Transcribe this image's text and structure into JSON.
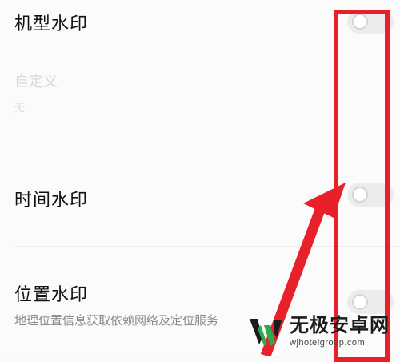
{
  "settings": {
    "model_watermark": {
      "title": "机型水印"
    },
    "custom": {
      "label": "自定义",
      "value": "无"
    },
    "time_watermark": {
      "title": "时间水印"
    },
    "location_watermark": {
      "title": "位置水印",
      "description": "地理位置信息获取依赖网络及定位服务"
    }
  },
  "toggles": {
    "model_watermark": "off",
    "time_watermark": "off",
    "location_watermark": "off"
  },
  "annotation": {
    "box_color": "#e8202a",
    "arrow_color": "#e8202a"
  },
  "watermark": {
    "title": "无极安卓网",
    "url": "wjhotelgroup.com",
    "logo_color_green": "#2fa84f",
    "logo_color_black": "#1c1c1c"
  }
}
